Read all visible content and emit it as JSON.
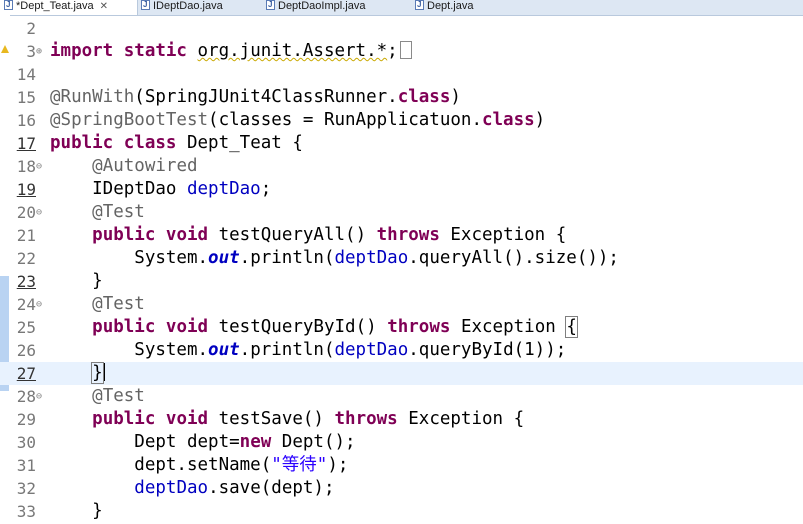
{
  "tabs": [
    {
      "label": "*Dept_Teat.java",
      "close": "✕",
      "active": true
    },
    {
      "label": "IDeptDao.java",
      "active": false
    },
    {
      "label": "DeptDaoImpl.java",
      "active": false
    },
    {
      "label": "Dept.java",
      "active": false
    }
  ],
  "lines": [
    {
      "num": "2",
      "fold": "",
      "segments": []
    },
    {
      "num": "3",
      "fold": "⊕",
      "segments": [
        {
          "c": "kw",
          "t": "import static"
        },
        {
          "t": " "
        },
        {
          "c": "squig",
          "t": "org.junit.Assert.*"
        },
        {
          "t": ";"
        },
        {
          "c": "ellipsis",
          "t": ""
        }
      ]
    },
    {
      "num": "14",
      "fold": "",
      "segments": []
    },
    {
      "num": "15",
      "fold": "",
      "segments": [
        {
          "c": "ann",
          "t": "@RunWith"
        },
        {
          "t": "(SpringJUnit4ClassRunner."
        },
        {
          "c": "kw",
          "t": "class"
        },
        {
          "t": ")"
        }
      ]
    },
    {
      "num": "16",
      "fold": "",
      "segments": [
        {
          "c": "ann",
          "t": "@SpringBootTest"
        },
        {
          "t": "(classes = RunApplicatuon."
        },
        {
          "c": "kw",
          "t": "class"
        },
        {
          "t": ")"
        }
      ]
    },
    {
      "num": "17",
      "fold": "",
      "mod": true,
      "segments": [
        {
          "c": "kw",
          "t": "public class"
        },
        {
          "t": " Dept_Teat {"
        }
      ]
    },
    {
      "num": "18",
      "fold": "⊖",
      "segments": [
        {
          "t": "    "
        },
        {
          "c": "ann",
          "t": "@Autowired"
        }
      ]
    },
    {
      "num": "19",
      "fold": "",
      "mod": true,
      "segments": [
        {
          "t": "    IDeptDao "
        },
        {
          "c": "fld",
          "t": "deptDao"
        },
        {
          "t": ";"
        }
      ]
    },
    {
      "num": "20",
      "fold": "⊖",
      "segments": [
        {
          "t": "    "
        },
        {
          "c": "ann",
          "t": "@Test"
        }
      ]
    },
    {
      "num": "21",
      "fold": "",
      "segments": [
        {
          "t": "    "
        },
        {
          "c": "kw",
          "t": "public void"
        },
        {
          "t": " testQueryAll() "
        },
        {
          "c": "kw",
          "t": "throws"
        },
        {
          "t": " Exception {"
        }
      ]
    },
    {
      "num": "22",
      "fold": "",
      "segments": [
        {
          "t": "        System."
        },
        {
          "c": "sf",
          "t": "out"
        },
        {
          "t": ".println("
        },
        {
          "c": "fld",
          "t": "deptDao"
        },
        {
          "t": ".queryAll().size());"
        }
      ]
    },
    {
      "num": "23",
      "fold": "",
      "mod": true,
      "segments": [
        {
          "t": "    }"
        }
      ]
    },
    {
      "num": "24",
      "fold": "⊖",
      "segments": [
        {
          "t": "    "
        },
        {
          "c": "ann",
          "t": "@Test"
        }
      ]
    },
    {
      "num": "25",
      "fold": "",
      "segments": [
        {
          "t": "    "
        },
        {
          "c": "kw",
          "t": "public void"
        },
        {
          "t": " testQueryById() "
        },
        {
          "c": "kw",
          "t": "throws"
        },
        {
          "t": " Exception "
        },
        {
          "c": "bracket",
          "t": "{"
        }
      ]
    },
    {
      "num": "26",
      "fold": "",
      "segments": [
        {
          "t": "        System."
        },
        {
          "c": "sf",
          "t": "out"
        },
        {
          "t": ".println("
        },
        {
          "c": "fld",
          "t": "deptDao"
        },
        {
          "t": ".queryById(1));"
        }
      ]
    },
    {
      "num": "27",
      "fold": "",
      "mod": true,
      "current": true,
      "segments": [
        {
          "t": "    "
        },
        {
          "c": "bracket",
          "t": "}"
        },
        {
          "c": "caret",
          "t": ""
        }
      ]
    },
    {
      "num": "28",
      "fold": "⊖",
      "segments": [
        {
          "t": "    "
        },
        {
          "c": "ann",
          "t": "@Test"
        }
      ]
    },
    {
      "num": "29",
      "fold": "",
      "segments": [
        {
          "t": "    "
        },
        {
          "c": "kw",
          "t": "public void"
        },
        {
          "t": " testSave() "
        },
        {
          "c": "kw",
          "t": "throws"
        },
        {
          "t": " Exception {"
        }
      ]
    },
    {
      "num": "30",
      "fold": "",
      "segments": [
        {
          "t": "        Dept "
        },
        {
          "c": "",
          "t": "dept="
        },
        {
          "c": "kw",
          "t": "new"
        },
        {
          "t": " Dept();"
        }
      ]
    },
    {
      "num": "31",
      "fold": "",
      "segments": [
        {
          "t": "        dept.setName("
        },
        {
          "c": "str",
          "t": "\"等待\""
        },
        {
          "t": ");"
        }
      ]
    },
    {
      "num": "32",
      "fold": "",
      "segments": [
        {
          "t": "        "
        },
        {
          "c": "fld",
          "t": "deptDao"
        },
        {
          "t": ".save(dept);"
        }
      ]
    },
    {
      "num": "33",
      "fold": "",
      "segments": [
        {
          "t": "    }"
        }
      ]
    }
  ]
}
